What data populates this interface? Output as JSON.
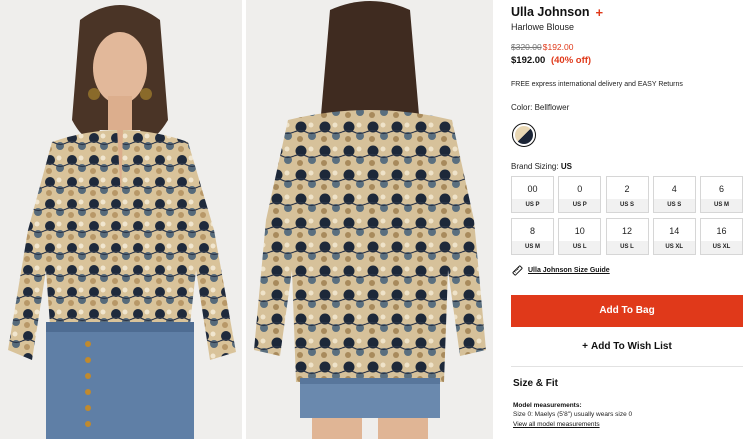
{
  "product": {
    "brand": "Ulla Johnson",
    "brand_plus": "+",
    "name": "Harlowe Blouse",
    "price_original": "$320.00",
    "price_sale": "$192.00",
    "price_current": "$192.00",
    "price_discount": "(40% off)",
    "delivery_note": "FREE express international delivery and EASY Returns",
    "color_label": "Color:",
    "color_value": "Bellflower",
    "swatch_colors": [
      "#e9d7b3",
      "#1b2436"
    ]
  },
  "sizing": {
    "label": "Brand Sizing:",
    "region": "US",
    "sizes": [
      {
        "num": "00",
        "us": "US P"
      },
      {
        "num": "0",
        "us": "US P"
      },
      {
        "num": "2",
        "us": "US S"
      },
      {
        "num": "4",
        "us": "US S"
      },
      {
        "num": "6",
        "us": "US M"
      },
      {
        "num": "8",
        "us": "US M"
      },
      {
        "num": "10",
        "us": "US L"
      },
      {
        "num": "12",
        "us": "US L"
      },
      {
        "num": "14",
        "us": "US XL"
      },
      {
        "num": "16",
        "us": "US XL"
      }
    ],
    "guide_link": "Ulla Johnson Size Guide"
  },
  "actions": {
    "add_to_bag": "Add To Bag",
    "wishlist_plus": "+",
    "wishlist": "Add To Wish List"
  },
  "size_fit": {
    "title": "Size & Fit",
    "model_heading": "Model measurements:",
    "model_text": "Size 0: Maelys (5'8\") usually wears size 0",
    "model_link": "View all model measurements"
  },
  "colors": {
    "accent": "#e0391a",
    "text": "#111111"
  }
}
